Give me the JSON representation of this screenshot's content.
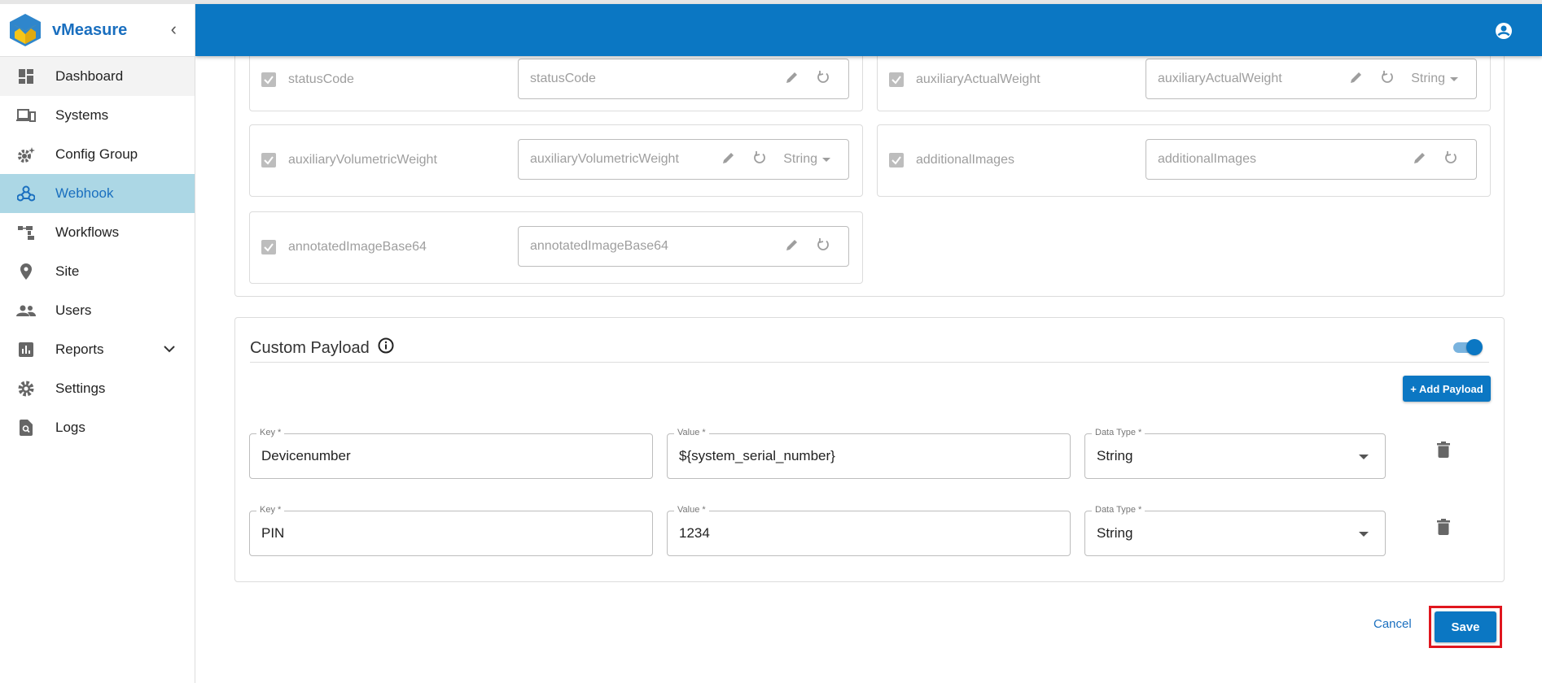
{
  "app": {
    "brand": "vMeasure"
  },
  "sidebar": {
    "items": [
      {
        "label": "Dashboard",
        "icon": "dashboard-icon"
      },
      {
        "label": "Systems",
        "icon": "devices-icon"
      },
      {
        "label": "Config Group",
        "icon": "config-gear-icon"
      },
      {
        "label": "Webhook",
        "icon": "webhook-icon"
      },
      {
        "label": "Workflows",
        "icon": "workflow-icon"
      },
      {
        "label": "Site",
        "icon": "location-pin-icon"
      },
      {
        "label": "Users",
        "icon": "users-icon"
      },
      {
        "label": "Reports",
        "icon": "bar-chart-icon"
      },
      {
        "label": "Settings",
        "icon": "settings-gear-icon"
      },
      {
        "label": "Logs",
        "icon": "log-search-icon"
      }
    ]
  },
  "fields": [
    {
      "label": "statusCode",
      "value": "statusCode"
    },
    {
      "label": "auxiliaryActualWeight",
      "value": "auxiliaryActualWeight",
      "type": "String"
    },
    {
      "label": "auxiliaryVolumetricWeight",
      "value": "auxiliaryVolumetricWeight",
      "type": "String"
    },
    {
      "label": "additionalImages",
      "value": "additionalImages"
    },
    {
      "label": "annotatedImageBase64",
      "value": "annotatedImageBase64"
    }
  ],
  "custom_payload": {
    "title": "Custom Payload",
    "enabled": true,
    "add_label": "+ Add Payload",
    "key_label": "Key *",
    "value_label": "Value *",
    "type_label": "Data Type *",
    "rows": [
      {
        "key": "Devicenumber",
        "value": "${system_serial_number}",
        "type": "String"
      },
      {
        "key": "PIN",
        "value": "1234",
        "type": "String"
      }
    ]
  },
  "actions": {
    "cancel": "Cancel",
    "save": "Save"
  },
  "colors": {
    "primary": "#0b77c3",
    "highlight": "#e0161e",
    "active_nav": "#acd7e5"
  }
}
